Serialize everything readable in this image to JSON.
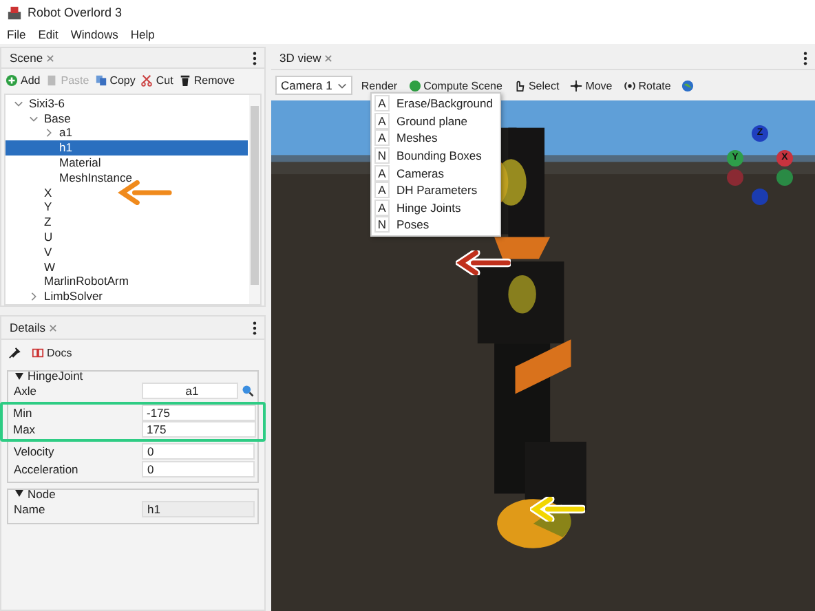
{
  "window": {
    "title": "Robot Overlord 3"
  },
  "menu": [
    "File",
    "Edit",
    "Windows",
    "Help"
  ],
  "scene_panel": {
    "tab": "Scene",
    "toolbar": [
      {
        "kind": "add",
        "label": "Add",
        "disabled": false
      },
      {
        "kind": "paste",
        "label": "Paste",
        "disabled": true
      },
      {
        "kind": "copy",
        "label": "Copy",
        "disabled": false
      },
      {
        "kind": "cut",
        "label": "Cut",
        "disabled": false
      },
      {
        "kind": "remove",
        "label": "Remove",
        "disabled": false
      }
    ],
    "tree": [
      {
        "label": "Sixi3-6",
        "expanded": true,
        "selected": false,
        "children": [
          {
            "label": "Base",
            "expanded": true,
            "selected": false,
            "children": [
              {
                "label": "a1",
                "expanded": false,
                "selected": false
              },
              {
                "label": "h1",
                "selected": true
              },
              {
                "label": "Material",
                "selected": false
              },
              {
                "label": "MeshInstance",
                "selected": false
              }
            ]
          },
          {
            "label": "X",
            "selected": false
          },
          {
            "label": "Y",
            "selected": false
          },
          {
            "label": "Z",
            "selected": false
          },
          {
            "label": "U",
            "selected": false
          },
          {
            "label": "V",
            "selected": false
          },
          {
            "label": "W",
            "selected": false
          },
          {
            "label": "MarlinRobotArm",
            "selected": false
          },
          {
            "label": "LimbSolver",
            "expanded": false,
            "selected": false
          }
        ]
      }
    ]
  },
  "details_panel": {
    "tab": "Details",
    "docs": "Docs",
    "groups": [
      {
        "title": "HingeJoint",
        "fields": [
          {
            "label": "Axle",
            "value": "a1",
            "kind": "link"
          },
          {
            "label": "Min",
            "value": "-175",
            "kind": "text",
            "highlighted": true
          },
          {
            "label": "Max",
            "value": "175",
            "kind": "text",
            "highlighted": true
          },
          {
            "label": "Velocity",
            "value": "0",
            "kind": "text"
          },
          {
            "label": "Acceleration",
            "value": "0",
            "kind": "text"
          }
        ]
      },
      {
        "title": "Node",
        "fields": [
          {
            "label": "Name",
            "value": "h1",
            "kind": "readonly"
          }
        ]
      }
    ]
  },
  "view_panel": {
    "tab": "3D view",
    "camera": "Camera 1",
    "toolbar": [
      {
        "kind": "menu",
        "label": "Render"
      },
      {
        "kind": "compute",
        "label": "Compute Scene"
      },
      {
        "kind": "select",
        "label": "Select"
      },
      {
        "kind": "move",
        "label": "Move"
      },
      {
        "kind": "rotate",
        "label": "Rotate"
      },
      {
        "kind": "globe"
      }
    ],
    "render_menu": [
      {
        "mode": "A",
        "label": "Erase/Background"
      },
      {
        "mode": "A",
        "label": "Ground plane"
      },
      {
        "mode": "A",
        "label": "Meshes"
      },
      {
        "mode": "N",
        "label": "Bounding Boxes"
      },
      {
        "mode": "A",
        "label": "Cameras"
      },
      {
        "mode": "A",
        "label": "DH Parameters"
      },
      {
        "mode": "A",
        "label": "Hinge Joints"
      },
      {
        "mode": "N",
        "label": "Poses"
      }
    ],
    "gizmo": [
      {
        "label": "Z",
        "color": "#1f3fbf"
      },
      {
        "label": "Y",
        "color": "#2e9e4a"
      },
      {
        "label": "X",
        "color": "#c8333f"
      }
    ]
  }
}
